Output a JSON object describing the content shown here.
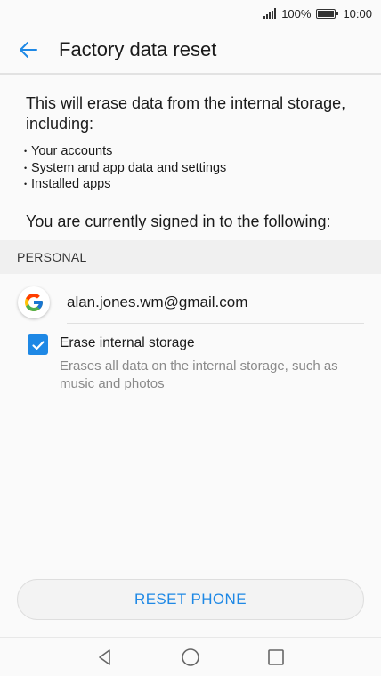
{
  "status_bar": {
    "battery_percent": "100%",
    "time": "10:00",
    "icons": [
      "signal-icon",
      "battery-icon"
    ]
  },
  "app_bar": {
    "title": "Factory data reset",
    "back_icon": "back-arrow-icon"
  },
  "content": {
    "intro": "This will erase data from the internal storage, including:",
    "bullets": [
      "Your accounts",
      "System and app data and settings",
      "Installed apps"
    ],
    "signed_in_text": "You are currently signed in to the following:"
  },
  "accounts_section": {
    "header": "PERSONAL",
    "accounts": [
      {
        "icon": "google-icon",
        "email": "alan.jones.wm@gmail.com"
      }
    ]
  },
  "erase_option": {
    "title": "Erase internal storage",
    "description": "Erases all data on the internal storage, such as music and photos",
    "checked": true
  },
  "actions": {
    "reset_label": "RESET PHONE"
  },
  "nav_bar": {
    "buttons": [
      "back-triangle-icon",
      "home-circle-icon",
      "recents-square-icon"
    ]
  },
  "colors": {
    "accent": "#1e88e5",
    "background": "#fafafa",
    "section_bg": "#f0f0f0",
    "secondary_text": "#8a8a8a"
  }
}
